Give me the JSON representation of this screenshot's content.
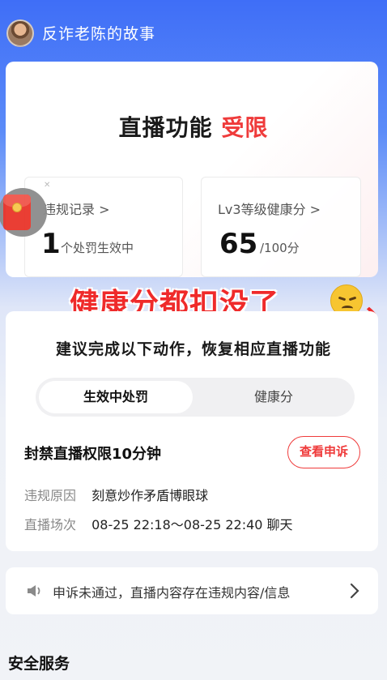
{
  "header": {
    "account_name": "反诈老陈的故事"
  },
  "status_card": {
    "title_prefix": "直播功能",
    "title_highlight": "受限",
    "violation": {
      "label": "违规记录 >",
      "value": "1",
      "unit": "个处罚生效中"
    },
    "health": {
      "label": "Lv3等级健康分 >",
      "value": "65",
      "unit": "/100分"
    }
  },
  "overlay": {
    "caption": "健康分都扣没了",
    "trail": "、"
  },
  "suggestions": {
    "title": "建议完成以下动作，恢复相应直播功能",
    "tabs": [
      {
        "label": "生效中处罚",
        "active": true
      },
      {
        "label": "健康分",
        "active": false
      }
    ],
    "penalty": {
      "title": "封禁直播权限10分钟",
      "appeal_button": "查看申诉",
      "reason_label": "违规原因",
      "reason_value": "刻意炒作矛盾博眼球",
      "session_label": "直播场次",
      "session_value": "08-25 22:18～08-25 22:40 聊天"
    }
  },
  "notice": {
    "text": "申诉未通过，直播内容存在违规内容/信息"
  },
  "sections": {
    "security_title": "安全服务"
  },
  "colors": {
    "accent_red": "#ef3b3b",
    "header_blue": "#3f6ef7"
  }
}
